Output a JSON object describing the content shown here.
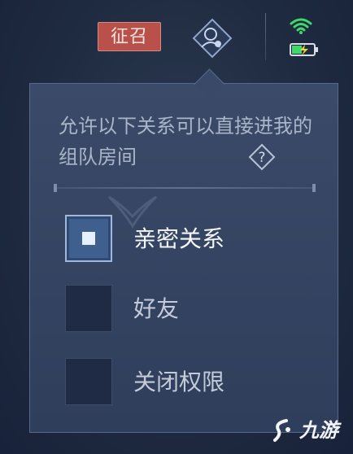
{
  "topbar": {
    "recruit_label": "征召",
    "icons": [
      "person-badge-icon",
      "wifi-icon",
      "battery-charging-icon"
    ],
    "accent_color": "#b9504a",
    "wifi_color": "#3fd86a"
  },
  "panel": {
    "description": "允许以下关系可以直接进我的组队房间",
    "help_icon": "question-icon",
    "options": [
      {
        "label": "亲密关系",
        "checked": true
      },
      {
        "label": "好友",
        "checked": false
      },
      {
        "label": "关闭权限",
        "checked": false
      }
    ]
  },
  "watermark": {
    "text": "九游"
  }
}
